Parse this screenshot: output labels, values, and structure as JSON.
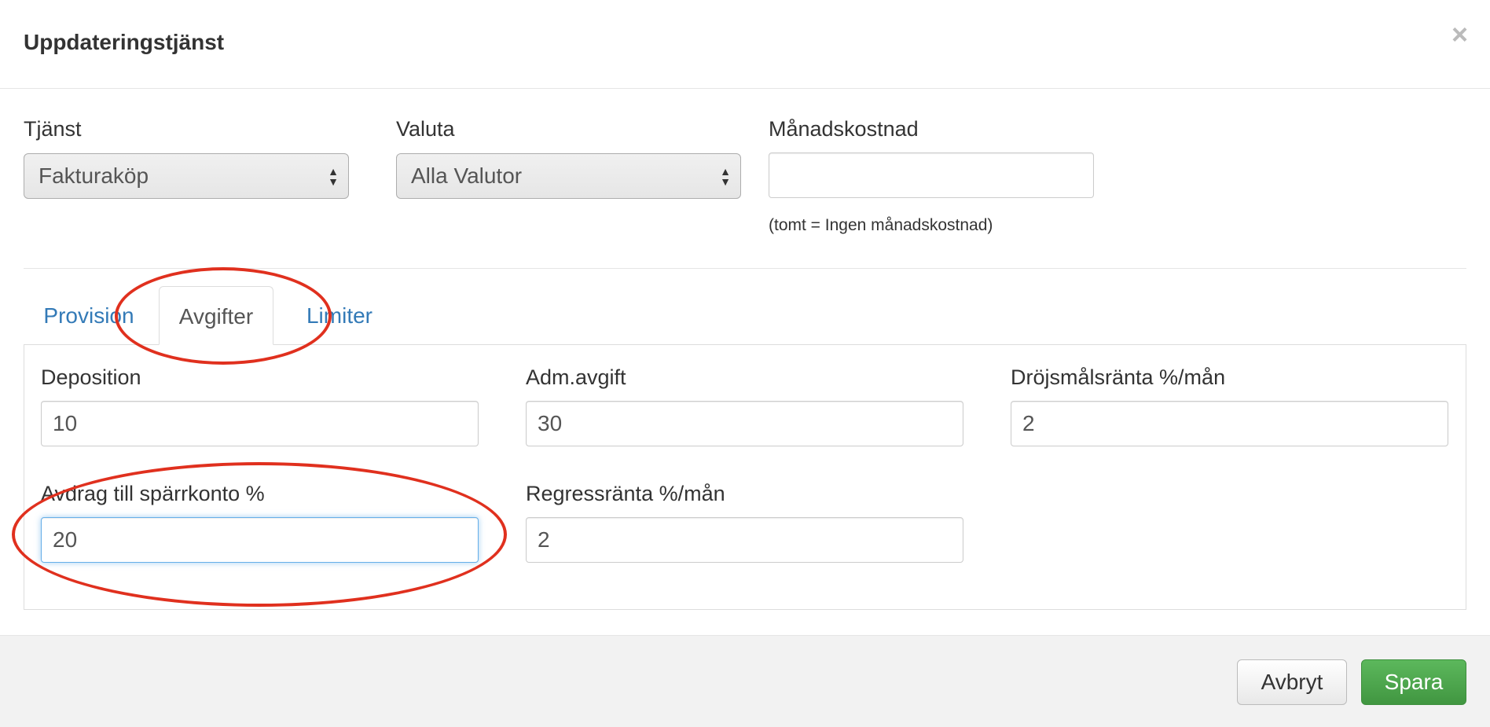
{
  "modal": {
    "title": "Uppdateringstjänst",
    "close_symbol": "×"
  },
  "top_form": {
    "service_label": "Tjänst",
    "service_value": "Fakturaköp",
    "currency_label": "Valuta",
    "currency_value": "Alla Valutor",
    "monthly_cost_label": "Månadskostnad",
    "monthly_cost_value": "",
    "monthly_cost_help": "(tomt = Ingen månadskostnad)"
  },
  "tabs": [
    {
      "label": "Provision",
      "active": false
    },
    {
      "label": "Avgifter",
      "active": true
    },
    {
      "label": "Limiter",
      "active": false
    }
  ],
  "fees": {
    "deposition_label": "Deposition",
    "deposition_value": "10",
    "adm_fee_label": "Adm.avgift",
    "adm_fee_value": "30",
    "late_interest_label": "Dröjsmålsränta %/mån",
    "late_interest_value": "2",
    "blocked_account_label": "Avdrag till spärrkonto %",
    "blocked_account_value": "20",
    "recourse_interest_label": "Regressränta %/mån",
    "recourse_interest_value": "2"
  },
  "footer": {
    "cancel_label": "Avbryt",
    "save_label": "Spara"
  },
  "colors": {
    "link": "#337ab7",
    "success": "#5cb85c",
    "annotation": "#e0301e",
    "focus": "#66afe9"
  }
}
